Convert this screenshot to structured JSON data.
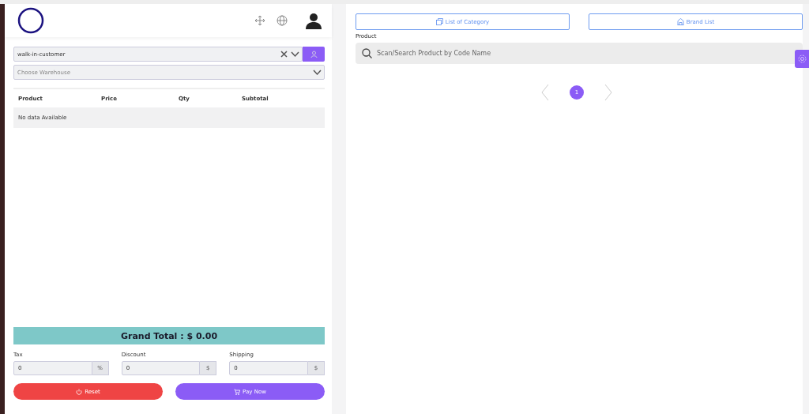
{
  "customer": {
    "value": "walk-in-customer"
  },
  "warehouse": {
    "placeholder": "Choose Warehouse"
  },
  "table": {
    "columns": [
      "Product",
      "Price",
      "Qty",
      "Subtotal"
    ],
    "empty": "No data Available"
  },
  "grand_total": "Grand Total : $ 0.00",
  "fields": [
    {
      "label": "Tax",
      "value": "0",
      "unit": "%"
    },
    {
      "label": "Discount",
      "value": "0",
      "unit": "$"
    },
    {
      "label": "Shipping",
      "value": "0",
      "unit": "$"
    }
  ],
  "buttons": [
    {
      "kind": "reset",
      "label": "Reset"
    },
    {
      "kind": "pay",
      "label": "Pay Now"
    }
  ],
  "lists": [
    {
      "kind": "category",
      "label": "List of Category"
    },
    {
      "kind": "brand",
      "label": "Brand List"
    }
  ],
  "product": {
    "label": "Product",
    "placeholder": "Scan/Search Product by Code Name"
  },
  "pages": [
    {
      "label": "1",
      "selected": true
    }
  ]
}
